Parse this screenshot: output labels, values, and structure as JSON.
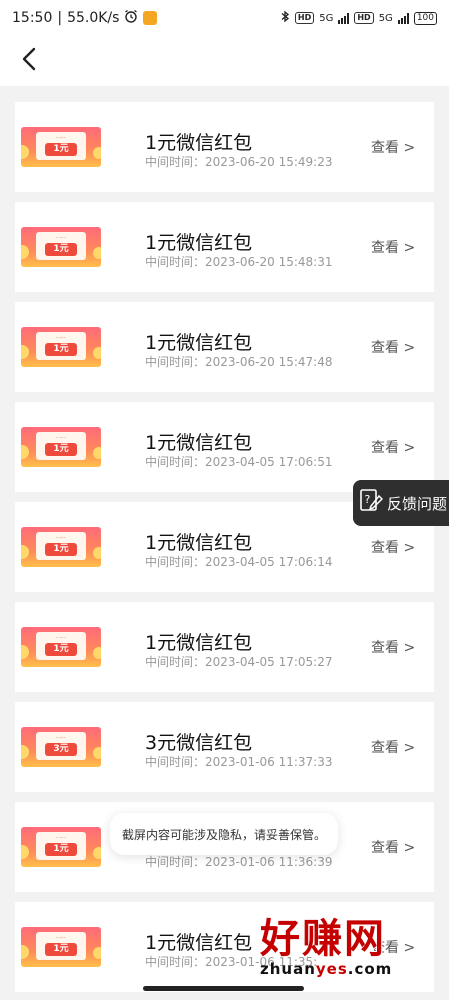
{
  "status_bar": {
    "time": "15:50",
    "network_speed": "55.0K/s",
    "alarm_icon": "alarm-clock-icon",
    "hd_label": "HD",
    "net_type": "5G",
    "battery": "100"
  },
  "header": {
    "back_icon": "chevron-left-icon"
  },
  "records": [
    {
      "title": "1元微信红包",
      "time_label": "中间时间：",
      "time": "2023-06-20 15:49:23",
      "thumb_amount": "1元",
      "action": "查看 >"
    },
    {
      "title": "1元微信红包",
      "time_label": "中间时间：",
      "time": "2023-06-20 15:48:31",
      "thumb_amount": "1元",
      "action": "查看 >"
    },
    {
      "title": "1元微信红包",
      "time_label": "中间时间：",
      "time": "2023-06-20 15:47:48",
      "thumb_amount": "1元",
      "action": "查看 >"
    },
    {
      "title": "1元微信红包",
      "time_label": "中间时间：",
      "time": "2023-04-05 17:06:51",
      "thumb_amount": "1元",
      "action": "查看 >"
    },
    {
      "title": "1元微信红包",
      "time_label": "中间时间：",
      "time": "2023-04-05 17:06:14",
      "thumb_amount": "1元",
      "action": "查看 >"
    },
    {
      "title": "1元微信红包",
      "time_label": "中间时间：",
      "time": "2023-04-05 17:05:27",
      "thumb_amount": "1元",
      "action": "查看 >"
    },
    {
      "title": "3元微信红包",
      "time_label": "中间时间：",
      "time": "2023-01-06 11:37:33",
      "thumb_amount": "3元",
      "action": "查看 >"
    },
    {
      "title": "",
      "time_label": "中间时间：",
      "time": "2023-01-06 11:36:39",
      "thumb_amount": "1元",
      "action": "查看 >"
    },
    {
      "title": "1元微信红包",
      "time_label": "中间时间：",
      "time": "2023-01-06 11:35:",
      "thumb_amount": "1元",
      "action": "查看 >"
    }
  ],
  "feedback": {
    "label": "反馈问题",
    "icon": "feedback-edit-icon"
  },
  "toast": {
    "text": "截屏内容可能涉及隐私，请妥善保管。"
  },
  "watermark": {
    "text": "好赚网",
    "url_part1": "zhuan",
    "url_part2": "yes",
    "url_part3": ".com"
  },
  "colors": {
    "accent_red": "#ef4b3c",
    "feedback_bg": "#2f2f2f"
  }
}
